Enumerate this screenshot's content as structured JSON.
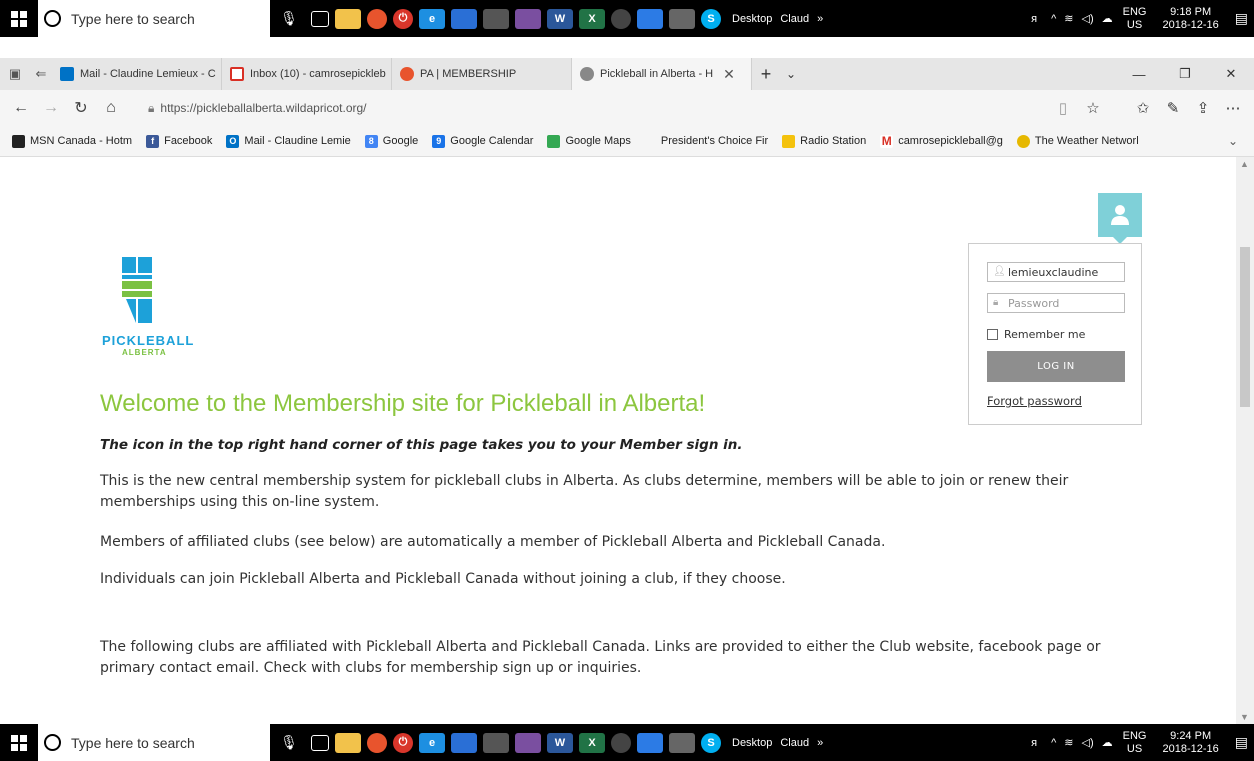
{
  "taskbar_top": {
    "search_placeholder": "Type here to search",
    "desktop_label": "Desktop",
    "user_label": "Claud",
    "more": "»",
    "lang_primary": "ENG",
    "lang_secondary": "US",
    "time": "9:18 PM",
    "date": "2018-12-16"
  },
  "taskbar_bottom": {
    "search_placeholder": "Type here to search",
    "desktop_label": "Desktop",
    "user_label": "Claud",
    "more": "»",
    "lang_primary": "ENG",
    "lang_secondary": "US",
    "time": "9:24 PM",
    "date": "2018-12-16"
  },
  "tabs": [
    {
      "label": "Mail - Claudine Lemieux - C",
      "icon_color": "#0072c6"
    },
    {
      "label": "Inbox (10) - camrosepickleb",
      "icon_color": "#d93025"
    },
    {
      "label": "PA | MEMBERSHIP",
      "icon_color": "#e8542d"
    },
    {
      "label": "Pickleball in Alberta - H",
      "icon_color": "#888888"
    }
  ],
  "address": {
    "url": "https://pickleballalberta.wildapricot.org/"
  },
  "favorites": [
    {
      "label": "MSN Canada - Hotm",
      "icon_color": "#222222",
      "icon_text": ""
    },
    {
      "label": "Facebook",
      "icon_color": "#3b5998",
      "icon_text": "f"
    },
    {
      "label": "Mail - Claudine Lemie",
      "icon_color": "#0072c6",
      "icon_text": "O"
    },
    {
      "label": "Google",
      "icon_color": "#4285f4",
      "icon_text": "8"
    },
    {
      "label": "Google Calendar",
      "icon_color": "#1a73e8",
      "icon_text": "9"
    },
    {
      "label": "Google Maps",
      "icon_color": "#34a853",
      "icon_text": ""
    },
    {
      "label": "President's Choice Fir",
      "icon_color": "#ffffff",
      "icon_text": ""
    },
    {
      "label": "Radio Station",
      "icon_color": "#f4c20d",
      "icon_text": ""
    },
    {
      "label": "camrosepickleball@g",
      "icon_color": "#d93025",
      "icon_text": "M"
    },
    {
      "label": "The Weather Networl",
      "icon_color": "#e6b800",
      "icon_text": ""
    }
  ],
  "page": {
    "logo_text": "PICKLEBALL",
    "logo_sub": "ALBERTA",
    "welcome": "Welcome to the Membership site for Pickleball in Alberta!",
    "intro": "The icon in the top right hand corner of this page takes you to your Member sign in.",
    "p1": "This is the new central membership system for  pickleball clubs in Alberta.  As clubs determine, members will be able to join or renew their memberships using this on-line system.",
    "p2": "Members of affiliated clubs (see below) are automatically a member of Pickleball Alberta and Pickleball Canada.",
    "p3": "Individuals can join Pickleball Alberta and Pickleball Canada without joining a club, if they choose.",
    "p4": "The following clubs are affiliated with Pickleball Alberta and Pickleball Canada.  Links are provided to either the Club website, facebook page or primary contact email.  Check with clubs for membership sign up or inquiries."
  },
  "login": {
    "username_value": "lemieuxclaudine",
    "password_placeholder": "Password",
    "remember_label": "Remember me",
    "login_button": "LOG IN",
    "forgot_link": "Forgot password"
  },
  "colors": {
    "welcome_green": "#8cc63f",
    "logo_blue": "#1da1d9",
    "avatar_teal": "#7fd0d8",
    "login_button_gray": "#8e8e8e"
  }
}
